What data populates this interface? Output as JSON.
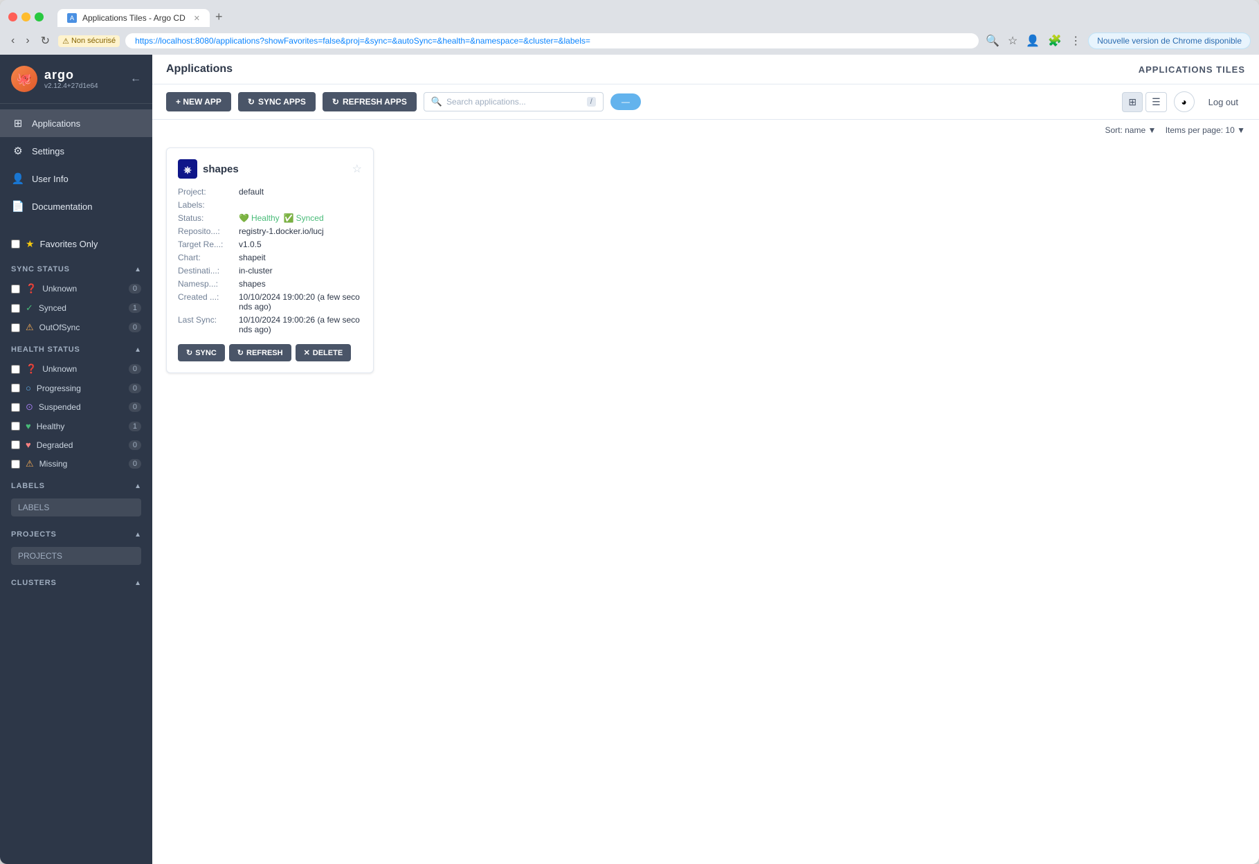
{
  "browser": {
    "tab_title": "Applications Tiles - Argo CD",
    "address": "https://localhost:8080/applications?showFavorites=false&proj=&sync=&autoSync=&health=&namespace=&cluster=&labels=",
    "security_label": "Non sécurisé",
    "update_notice": "Nouvelle version de Chrome disponible"
  },
  "sidebar": {
    "logo_name": "argo",
    "logo_version": "v2.12.4+27d1e64",
    "nav_items": [
      {
        "id": "applications",
        "label": "Applications",
        "icon": "⊞"
      },
      {
        "id": "settings",
        "label": "Settings",
        "icon": "⚙"
      },
      {
        "id": "user-info",
        "label": "User Info",
        "icon": "👤"
      },
      {
        "id": "documentation",
        "label": "Documentation",
        "icon": "📄"
      }
    ],
    "favorites_label": "Favorites Only",
    "sync_status_label": "SYNC STATUS",
    "sync_items": [
      {
        "id": "unknown",
        "label": "Unknown",
        "count": "0",
        "icon": "?"
      },
      {
        "id": "synced",
        "label": "Synced",
        "count": "1",
        "icon": "✓"
      },
      {
        "id": "outofsync",
        "label": "OutOfSync",
        "count": "0",
        "icon": "!"
      }
    ],
    "health_status_label": "HEALTH STATUS",
    "health_items": [
      {
        "id": "unknown",
        "label": "Unknown",
        "count": "0",
        "icon": "?"
      },
      {
        "id": "progressing",
        "label": "Progressing",
        "count": "0",
        "icon": "○"
      },
      {
        "id": "suspended",
        "label": "Suspended",
        "count": "0",
        "icon": "⊙"
      },
      {
        "id": "healthy",
        "label": "Healthy",
        "count": "1",
        "icon": "♥"
      },
      {
        "id": "degraded",
        "label": "Degraded",
        "count": "0",
        "icon": "♥"
      },
      {
        "id": "missing",
        "label": "Missing",
        "count": "0",
        "icon": "⚠"
      }
    ],
    "labels_section": "LABELS",
    "labels_placeholder": "LABELS",
    "projects_section": "PROJECTS",
    "projects_placeholder": "PROJECTS",
    "clusters_section": "CLUSTERS"
  },
  "main": {
    "title": "Applications",
    "view_label": "APPLICATIONS TILES",
    "sort_label": "Sort: name",
    "items_per_page_label": "Items per page: 10",
    "toolbar": {
      "new_app": "+ NEW APP",
      "sync_apps": "SYNC APPS",
      "refresh_apps": "REFRESH APPS",
      "search_placeholder": "Search applications...",
      "namespace_btn": "—",
      "logout": "Log out"
    },
    "app_card": {
      "name": "shapes",
      "project": "default",
      "labels": "",
      "status_healthy": "Healthy",
      "status_synced": "Synced",
      "repository": "registry-1.docker.io/lucj",
      "target_revision": "v1.0.5",
      "chart": "shapeit",
      "destination": "in-cluster",
      "namespace": "shapes",
      "created": "10/10/2024 19:00:20  (a few seconds ago)",
      "last_sync": "10/10/2024 19:00:26  (a few seconds ago)",
      "sync_btn": "SYNC",
      "refresh_btn": "REFRESH",
      "delete_btn": "DELETE"
    }
  }
}
